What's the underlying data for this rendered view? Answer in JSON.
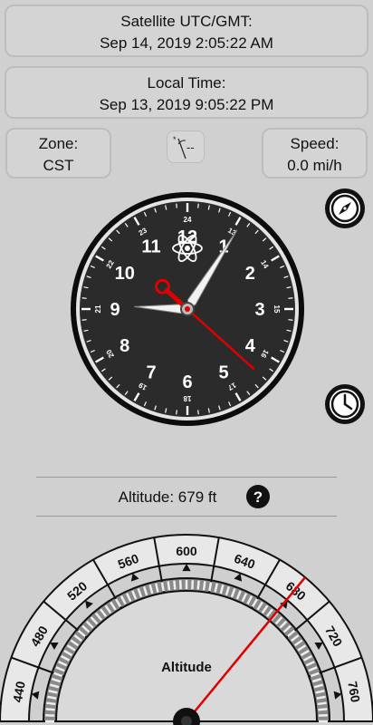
{
  "utc": {
    "label": "Satellite UTC/GMT:",
    "value": "Sep 14, 2019 2:05:22 AM"
  },
  "local": {
    "label": "Local Time:",
    "value": "Sep 13, 2019 9:05:22 PM"
  },
  "zone": {
    "label": "Zone:",
    "value": "CST"
  },
  "satellite_status": {
    "text": "--"
  },
  "speed": {
    "label": "Speed:",
    "value": "0.0 mi/h"
  },
  "clock": {
    "hours12": [
      "12",
      "1",
      "2",
      "3",
      "4",
      "5",
      "6",
      "7",
      "8",
      "9",
      "10",
      "11"
    ],
    "hours24": [
      "24",
      "13",
      "14",
      "15",
      "16",
      "17",
      "18",
      "19",
      "20",
      "21",
      "22",
      "23"
    ],
    "time": {
      "hour": 9,
      "minute": 5,
      "second": 22
    }
  },
  "altitude": {
    "label": "Altitude: 679 ft",
    "help_symbol": "?",
    "gauge_title": "Altitude",
    "scale_labels": [
      "440",
      "480",
      "520",
      "560",
      "600",
      "640",
      "680",
      "720",
      "760"
    ],
    "value_ft": 679
  },
  "icons": {
    "compass": "compass-icon",
    "clock": "clock-icon",
    "satellite": "satellite-icon",
    "help": "help-icon",
    "atom": "atom-icon"
  }
}
